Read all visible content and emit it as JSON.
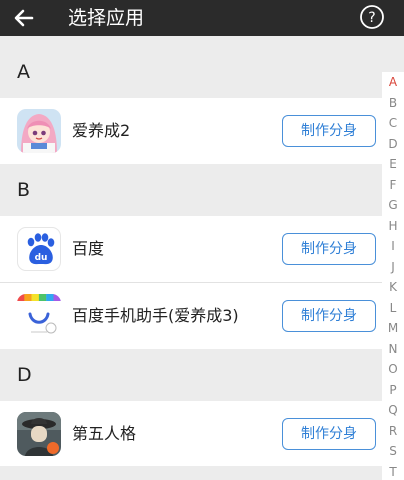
{
  "topbar": {
    "title": "选择应用",
    "help_symbol": "?"
  },
  "sections": [
    {
      "letter": "A",
      "apps": [
        {
          "name": "爱养成2",
          "button": "制作分身",
          "icon": "anime-girl-icon"
        }
      ]
    },
    {
      "letter": "B",
      "apps": [
        {
          "name": "百度",
          "button": "制作分身",
          "icon": "baidu-paw-icon"
        },
        {
          "name": "百度手机助手(爱养成3)",
          "button": "制作分身",
          "icon": "baidu-assistant-icon"
        }
      ]
    },
    {
      "letter": "D",
      "apps": [
        {
          "name": "第五人格",
          "button": "制作分身",
          "icon": "identity-v-icon"
        }
      ]
    }
  ],
  "index": {
    "active": "A",
    "letters": [
      "A",
      "B",
      "C",
      "D",
      "E",
      "F",
      "G",
      "H",
      "I",
      "J",
      "K",
      "L",
      "M",
      "N",
      "O",
      "P",
      "Q",
      "R",
      "S",
      "T"
    ]
  },
  "colors": {
    "topbar": "#2b2b2b",
    "button_border": "#4a90d9",
    "button_text": "#2f7fd6",
    "index_active": "#d9453a",
    "baidu_blue": "#2a5fe0"
  },
  "baidu_icon_text": "du"
}
